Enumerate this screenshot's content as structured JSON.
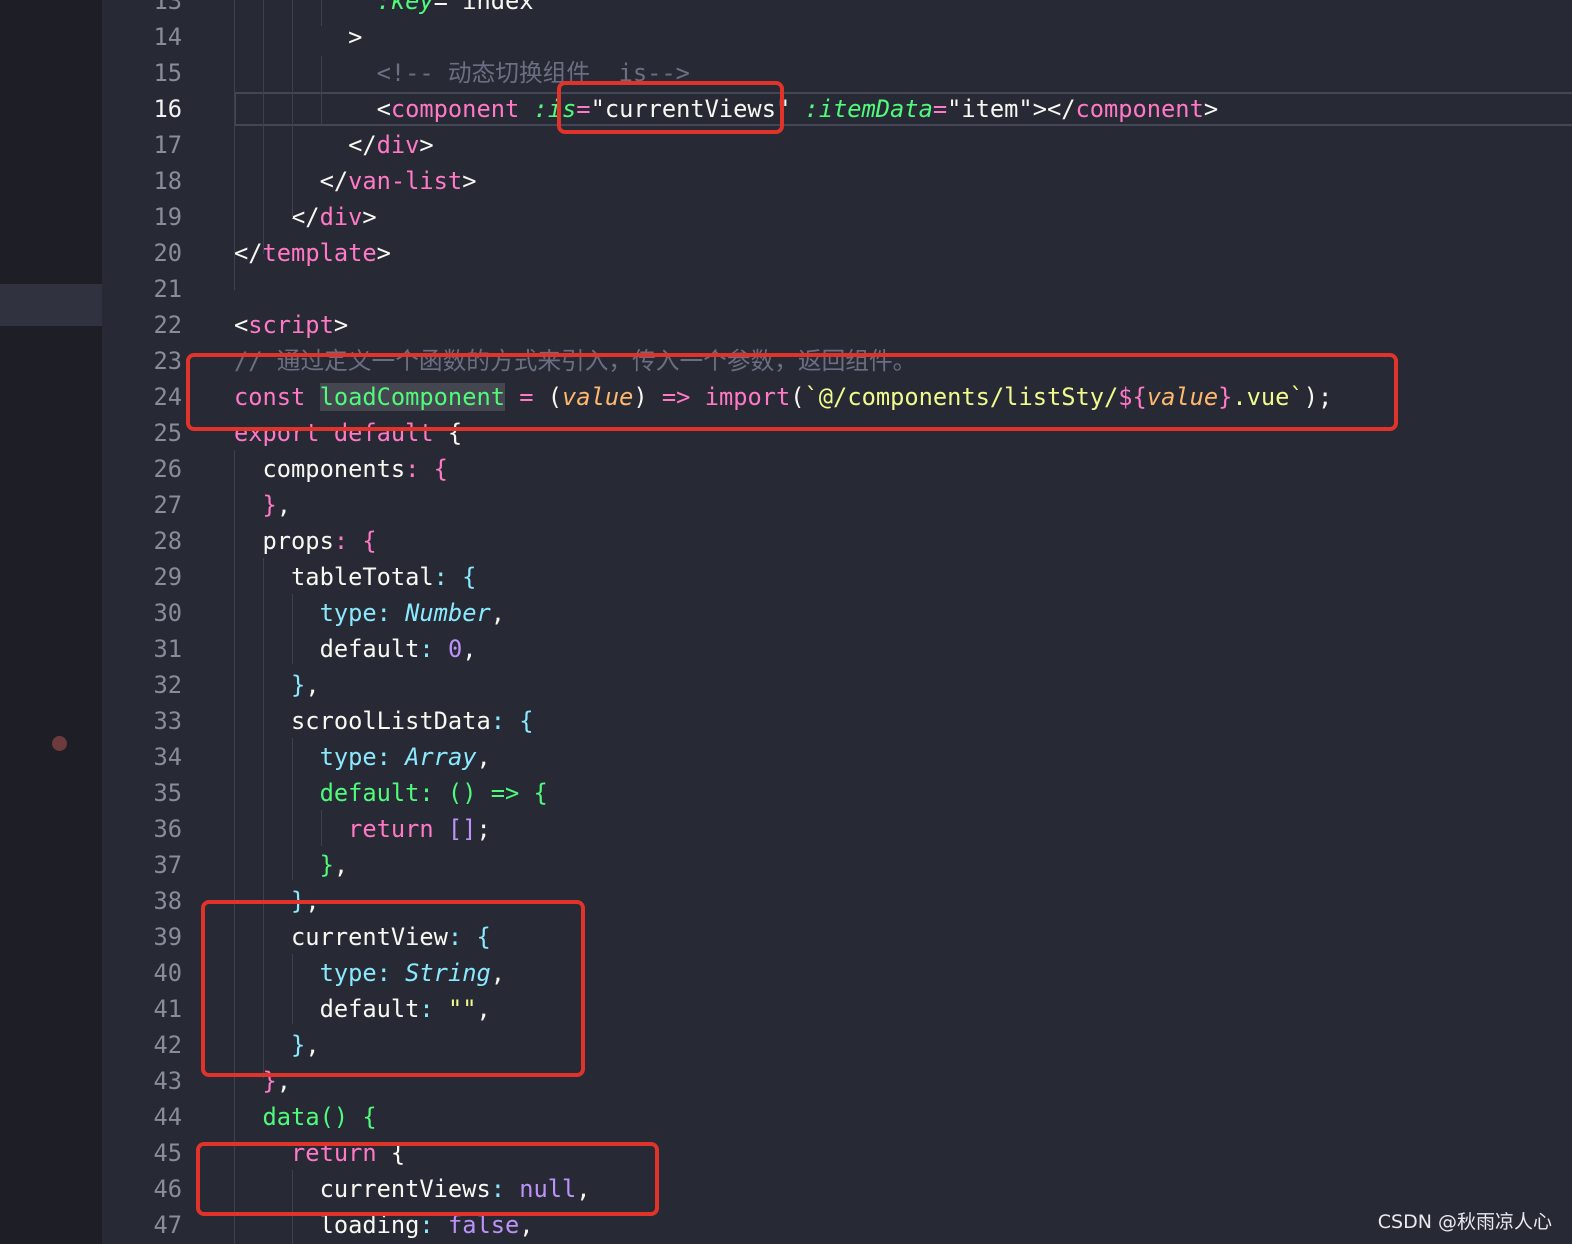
{
  "editor": {
    "lines": [
      {
        "num": "13",
        "parts": [
          {
            "t": "          "
          },
          {
            "t": ":key",
            "c": "t-attr"
          },
          {
            "t": "=\"",
            "c": "t-strw"
          },
          {
            "t": "index",
            "c": "t-strw"
          }
        ]
      },
      {
        "num": "14",
        "parts": [
          {
            "t": "        >"
          }
        ]
      },
      {
        "num": "15",
        "parts": [
          {
            "t": "          "
          },
          {
            "t": "<!-- 动态切换组件  is-->",
            "c": "t-cmt"
          }
        ]
      },
      {
        "num": "16",
        "parts": [
          {
            "t": "          <"
          },
          {
            "t": "component",
            "c": "t-tag"
          },
          {
            "t": " "
          },
          {
            "t": ":is",
            "c": "t-attr"
          },
          {
            "t": "=",
            "c": "t-tag"
          },
          {
            "t": "\"currentViews\""
          },
          {
            "t": " "
          },
          {
            "t": ":itemData",
            "c": "t-attr"
          },
          {
            "t": "=",
            "c": "t-tag"
          },
          {
            "t": "\"item\""
          },
          {
            "t": "></"
          },
          {
            "t": "component",
            "c": "t-tag"
          },
          {
            "t": ">"
          }
        ]
      },
      {
        "num": "17",
        "parts": [
          {
            "t": "        </"
          },
          {
            "t": "div",
            "c": "t-tag"
          },
          {
            "t": ">"
          }
        ]
      },
      {
        "num": "18",
        "parts": [
          {
            "t": "      </"
          },
          {
            "t": "van-list",
            "c": "t-tag"
          },
          {
            "t": ">"
          }
        ]
      },
      {
        "num": "19",
        "parts": [
          {
            "t": "    </"
          },
          {
            "t": "div",
            "c": "t-tag"
          },
          {
            "t": ">"
          }
        ]
      },
      {
        "num": "20",
        "parts": [
          {
            "t": "</"
          },
          {
            "t": "template",
            "c": "t-tag"
          },
          {
            "t": ">"
          }
        ]
      },
      {
        "num": "21",
        "parts": [
          {
            "t": ""
          }
        ]
      },
      {
        "num": "22",
        "parts": [
          {
            "t": "<"
          },
          {
            "t": "script",
            "c": "t-tag"
          },
          {
            "t": ">"
          }
        ]
      },
      {
        "num": "23",
        "parts": [
          {
            "t": "// 通过定义一个函数的方式来引入，传入一个参数，返回组件。",
            "c": "t-cmt"
          }
        ]
      },
      {
        "num": "24",
        "parts": [
          {
            "t": "const ",
            "c": "t-kw"
          },
          {
            "t": "loadComponent",
            "c": "t-sel"
          },
          {
            "t": " = ",
            "c": "t-kw"
          },
          {
            "t": "("
          },
          {
            "t": "value",
            "c": "t-param"
          },
          {
            "t": ") "
          },
          {
            "t": "=> ",
            "c": "t-kw"
          },
          {
            "t": "import",
            "c": "t-kw"
          },
          {
            "t": "("
          },
          {
            "t": "`@/components/listSty/",
            "c": "t-str"
          },
          {
            "t": "${",
            "c": "t-kw"
          },
          {
            "t": "value",
            "c": "t-param"
          },
          {
            "t": "}",
            "c": "t-kw"
          },
          {
            "t": ".vue`",
            "c": "t-str"
          },
          {
            "t": ");"
          }
        ]
      },
      {
        "num": "25",
        "parts": [
          {
            "t": "export default ",
            "c": "t-kw"
          },
          {
            "t": "{"
          }
        ]
      },
      {
        "num": "26",
        "parts": [
          {
            "t": "  components"
          },
          {
            "t": ": {",
            "c": "t-kw"
          }
        ]
      },
      {
        "num": "27",
        "parts": [
          {
            "t": "  "
          },
          {
            "t": "}",
            "c": "t-kw"
          },
          {
            "t": ","
          }
        ]
      },
      {
        "num": "28",
        "parts": [
          {
            "t": "  props"
          },
          {
            "t": ": {",
            "c": "t-kw"
          }
        ]
      },
      {
        "num": "29",
        "parts": [
          {
            "t": "    tableTotal"
          },
          {
            "t": ": {",
            "c": "t-prop"
          }
        ]
      },
      {
        "num": "30",
        "parts": [
          {
            "t": "      "
          },
          {
            "t": "type",
            "c": "t-prop"
          },
          {
            "t": ": ",
            "c": "t-prop"
          },
          {
            "t": "Number",
            "c": "t-type"
          },
          {
            "t": ","
          }
        ]
      },
      {
        "num": "31",
        "parts": [
          {
            "t": "      default"
          },
          {
            "t": ": ",
            "c": "t-prop"
          },
          {
            "t": "0",
            "c": "t-num"
          },
          {
            "t": ","
          }
        ]
      },
      {
        "num": "32",
        "parts": [
          {
            "t": "    "
          },
          {
            "t": "}",
            "c": "t-prop"
          },
          {
            "t": ","
          }
        ]
      },
      {
        "num": "33",
        "parts": [
          {
            "t": "    scroolListData"
          },
          {
            "t": ": {",
            "c": "t-prop"
          }
        ]
      },
      {
        "num": "34",
        "parts": [
          {
            "t": "      "
          },
          {
            "t": "type",
            "c": "t-prop"
          },
          {
            "t": ": ",
            "c": "t-prop"
          },
          {
            "t": "Array",
            "c": "t-type"
          },
          {
            "t": ","
          }
        ]
      },
      {
        "num": "35",
        "parts": [
          {
            "t": "      "
          },
          {
            "t": "default: () => {",
            "c": "t-fn"
          }
        ]
      },
      {
        "num": "36",
        "parts": [
          {
            "t": "        "
          },
          {
            "t": "return ",
            "c": "t-kw"
          },
          {
            "t": "[]",
            "c": "t-num"
          },
          {
            "t": ";"
          }
        ]
      },
      {
        "num": "37",
        "parts": [
          {
            "t": "      "
          },
          {
            "t": "}",
            "c": "t-fn"
          },
          {
            "t": ","
          }
        ]
      },
      {
        "num": "38",
        "parts": [
          {
            "t": "    "
          },
          {
            "t": "}",
            "c": "t-prop"
          },
          {
            "t": ","
          }
        ]
      },
      {
        "num": "39",
        "parts": [
          {
            "t": "    currentView"
          },
          {
            "t": ": {",
            "c": "t-prop"
          }
        ]
      },
      {
        "num": "40",
        "parts": [
          {
            "t": "      "
          },
          {
            "t": "type",
            "c": "t-prop"
          },
          {
            "t": ": ",
            "c": "t-prop"
          },
          {
            "t": "String",
            "c": "t-type"
          },
          {
            "t": ","
          }
        ]
      },
      {
        "num": "41",
        "parts": [
          {
            "t": "      default"
          },
          {
            "t": ": ",
            "c": "t-prop"
          },
          {
            "t": "\"\"",
            "c": "t-str"
          },
          {
            "t": ","
          }
        ]
      },
      {
        "num": "42",
        "parts": [
          {
            "t": "    "
          },
          {
            "t": "}",
            "c": "t-prop"
          },
          {
            "t": ","
          }
        ]
      },
      {
        "num": "43",
        "parts": [
          {
            "t": "  "
          },
          {
            "t": "}",
            "c": "t-kw"
          },
          {
            "t": ","
          }
        ]
      },
      {
        "num": "44",
        "parts": [
          {
            "t": "  "
          },
          {
            "t": "data() {",
            "c": "t-fn"
          }
        ]
      },
      {
        "num": "45",
        "parts": [
          {
            "t": "    "
          },
          {
            "t": "return ",
            "c": "t-kw"
          },
          {
            "t": "{"
          }
        ]
      },
      {
        "num": "46",
        "parts": [
          {
            "t": "      currentViews"
          },
          {
            "t": ": ",
            "c": "t-prop"
          },
          {
            "t": "null",
            "c": "t-num"
          },
          {
            "t": ","
          }
        ]
      },
      {
        "num": "47",
        "parts": [
          {
            "t": "      loading"
          },
          {
            "t": ": ",
            "c": "t-prop"
          },
          {
            "t": "false",
            "c": "t-num"
          },
          {
            "t": ","
          }
        ]
      }
    ],
    "active_line": "16"
  },
  "watermark": "CSDN @秋雨凉人心",
  "colors": {
    "background": "#272935",
    "gutter": "#1d1e26",
    "highlight_box": "#e0332a"
  }
}
